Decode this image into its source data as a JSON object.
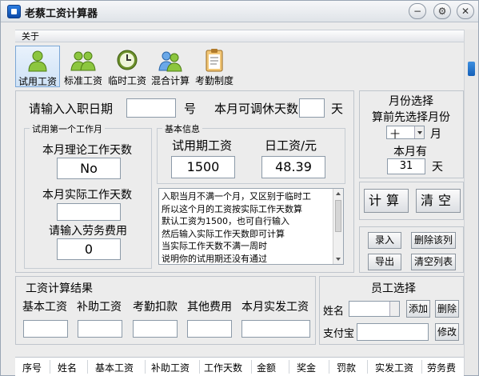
{
  "window": {
    "title": "老蔡工资计算器"
  },
  "menu": {
    "about": "关于"
  },
  "toolbar": [
    {
      "label": "试用工资",
      "icon": "single-person-icon"
    },
    {
      "label": "标准工资",
      "icon": "people-group-icon"
    },
    {
      "label": "临时工资",
      "icon": "clock-icon"
    },
    {
      "label": "混合计算",
      "icon": "people-mixed-icon"
    },
    {
      "label": "考勤制度",
      "icon": "clipboard-icon"
    }
  ],
  "main": {
    "entry_date_label": "请输入入职日期",
    "entry_date_value": "",
    "day_unit": "号",
    "off_days_label": "本月可调休天数",
    "off_days_value": "",
    "off_days_unit": "天",
    "first_month_group": "试用第一个工作月",
    "theory_days_label": "本月理论工作天数",
    "theory_days_value": "No",
    "actual_days_label": "本月实际工作天数",
    "actual_days_value": "",
    "labor_fee_label": "请输入劳务费用",
    "labor_fee_value": "0",
    "basic_info_group": "基本信息",
    "trial_wage_label": "试用期工资",
    "trial_wage_value": "1500",
    "daily_wage_label": "日工资/元",
    "daily_wage_value": "48.39",
    "notes": [
      "入职当月不满一个月，又区别于临时工",
      "所以这个月的工资按实际工作天数算",
      "默认工资为1500，也可自行输入",
      "然后输入实际工作天数即可计算",
      "当实际工作天数不满一周时",
      "说明你的试用期还没有通过"
    ]
  },
  "month": {
    "title": "月份选择",
    "hint": "算前先选择月份",
    "month_value": "十",
    "month_unit": "月",
    "days_label": "本月有",
    "days_value": "31",
    "days_unit": "天"
  },
  "buttons": {
    "calc": "计算",
    "clear": "清空",
    "record": "录入",
    "delete_row": "删除该列",
    "export": "导出",
    "clear_list": "清空列表"
  },
  "result": {
    "title": "工资计算结果",
    "columns": [
      "基本工资",
      "补助工资",
      "考勤扣款",
      "其他费用",
      "本月实发工资"
    ],
    "values": [
      "",
      "",
      "",
      "",
      ""
    ]
  },
  "employee": {
    "title": "员工选择",
    "name_label": "姓名",
    "name_value": "",
    "add": "添加",
    "delete": "删除",
    "alipay_label": "支付宝",
    "alipay_value": "",
    "modify": "修改"
  },
  "table": {
    "headers": [
      "序号",
      "姓名",
      "基本工资",
      "补助工资",
      "工作天数",
      "金额",
      "奖金",
      "罚款",
      "实发工资",
      "劳务费"
    ]
  },
  "colors": {
    "accent": "#1560b8",
    "panel_bg": "#ececec"
  }
}
